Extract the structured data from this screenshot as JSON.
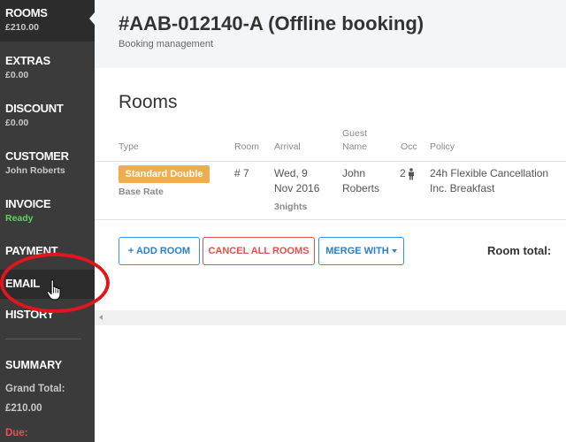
{
  "sidebar": {
    "items": [
      {
        "label": "ROOMS",
        "sub": "£210.00"
      },
      {
        "label": "EXTRAS",
        "sub": "£0.00"
      },
      {
        "label": "DISCOUNT",
        "sub": "£0.00"
      },
      {
        "label": "CUSTOMER",
        "sub": "John Roberts"
      },
      {
        "label": "INVOICE",
        "sub": "Ready"
      },
      {
        "label": "PAYMENT"
      },
      {
        "label": "EMAIL"
      },
      {
        "label": "HISTORY"
      }
    ],
    "summary": {
      "heading": "SUMMARY",
      "grand_total_label": "Grand Total:",
      "grand_total_value": "£210.00",
      "due_label": "Due:"
    }
  },
  "header": {
    "title": "#AAB-012140-A (Offline booking)",
    "subtitle": "Booking management"
  },
  "rooms": {
    "title": "Rooms",
    "columns": {
      "type": "Type",
      "room": "Room",
      "arrival": "Arrival",
      "guest_line1": "Guest",
      "guest_line2": "Name",
      "occ": "Occ",
      "policy": "Policy"
    },
    "row": {
      "type_badge": "Standard Double",
      "rate": "Base Rate",
      "room": "# 7",
      "arrival_line1": "Wed, 9",
      "arrival_line2": "Nov 2016",
      "nights": "3nights",
      "guest_line1": "John",
      "guest_line2": "Roberts",
      "occ": "2",
      "policy_line1": "24h Flexible Cancellation",
      "policy_line2": "Inc. Breakfast"
    },
    "buttons": {
      "add_room": "+ ADD ROOM",
      "cancel_all": "CANCEL ALL ROOMS",
      "merge_with": "MERGE WITH"
    },
    "room_total_label": "Room total:"
  },
  "colors": {
    "sidebar_bg": "#3b3b3b",
    "accent_blue": "#2d7ec4",
    "danger_red": "#d9534f",
    "badge_orange": "#f0ad4e",
    "ready_green": "#5bd65b",
    "annotation_red": "#e1151c"
  }
}
